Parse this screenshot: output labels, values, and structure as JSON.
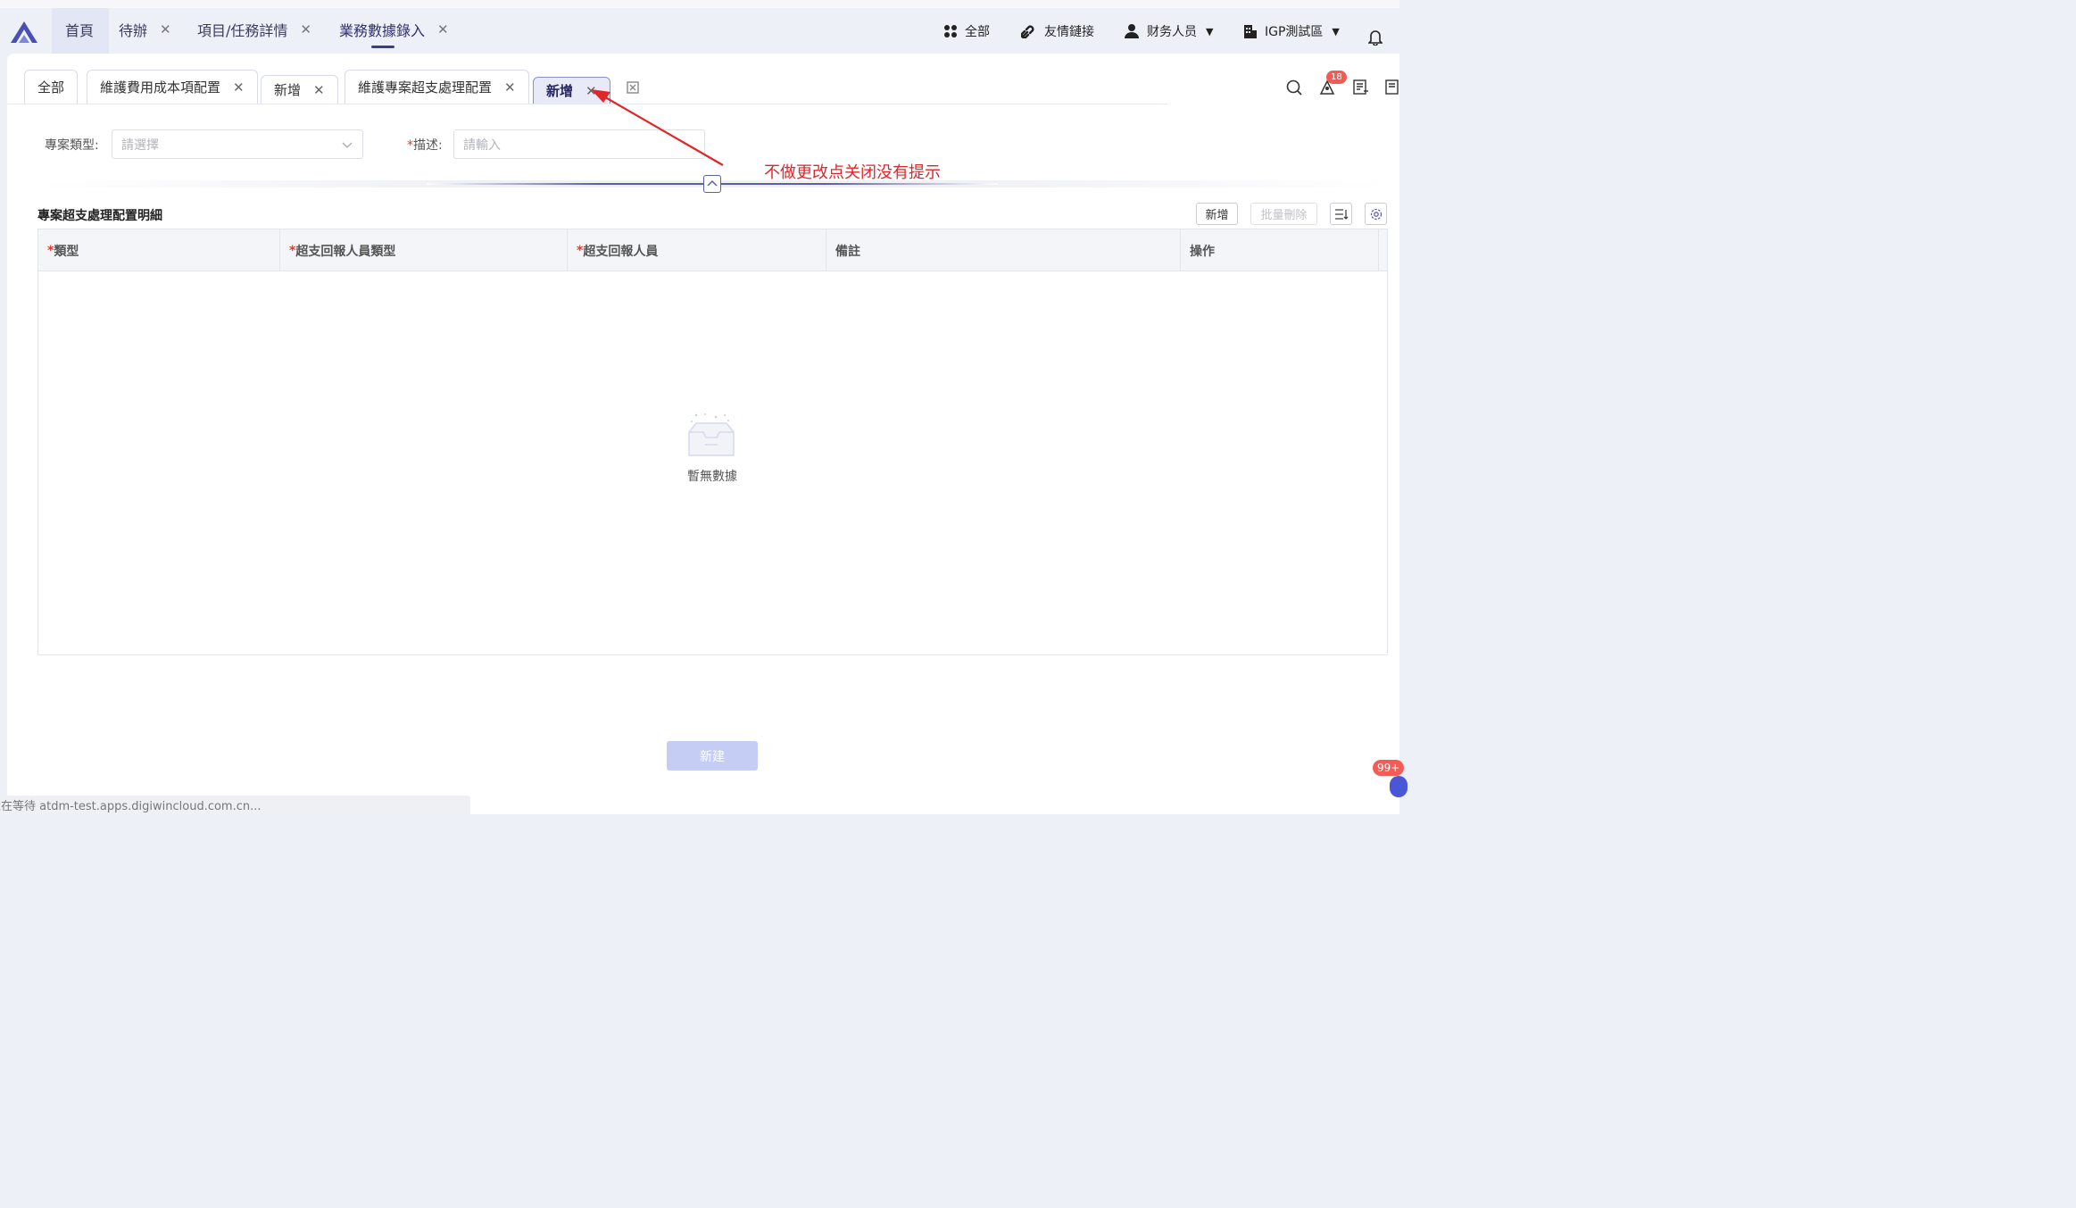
{
  "topnav": {
    "tabs": [
      {
        "label": "首頁"
      },
      {
        "label": "待辦"
      },
      {
        "label": "項目/任務詳情"
      },
      {
        "label": "業務數據錄入"
      }
    ],
    "right": {
      "all_label": "全部",
      "links_label": "友情鏈接",
      "user_label": "财务人员",
      "tenant_label": "IGP測試區"
    }
  },
  "page_tabs": [
    {
      "label": "全部"
    },
    {
      "label": "維護費用成本項配置"
    },
    {
      "label": "新增"
    },
    {
      "label": "維護專案超支處理配置"
    },
    {
      "label": "新增"
    }
  ],
  "toolbar": {
    "notification_count": "18"
  },
  "form": {
    "project_type_label": "專案類型:",
    "project_type_placeholder": "請選擇",
    "description_required_mark": "*",
    "description_label": "描述:",
    "description_placeholder": "請輸入"
  },
  "annotation": {
    "text": "不做更改点关闭没有提示"
  },
  "detail": {
    "title": "專案超支處理配置明細",
    "add_label": "新增",
    "batch_delete_label": "批量刪除",
    "columns": [
      {
        "required": "*",
        "label": "類型"
      },
      {
        "required": "*",
        "label": "超支回報人員類型"
      },
      {
        "required": "*",
        "label": "超支回報人員"
      },
      {
        "required": "",
        "label": "備註"
      },
      {
        "required": "",
        "label": "操作"
      }
    ],
    "empty_text": "暫無數據"
  },
  "footer": {
    "create_label": "新建"
  },
  "statusbar": {
    "text": "正在等待 atdm-test.apps.digiwincloud.com.cn..."
  },
  "float_badge": "99+",
  "colors": {
    "accent": "#3c3c8c",
    "annotation": "#e0262a",
    "required": "#e53935"
  }
}
